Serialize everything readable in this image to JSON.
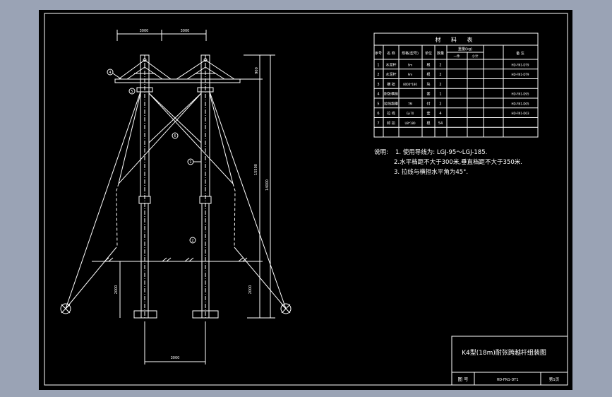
{
  "colors": {
    "frame_bg": "#000000",
    "outer_bg": "#9aa3b5",
    "line": "#ffffff",
    "accent": "#ff3030"
  },
  "dimensions": {
    "top_left": "3000",
    "top_right": "3000",
    "bottom": "3000",
    "crossarm_height": "900",
    "pole_above_ground": "15500",
    "pole_total": "14000",
    "foot_left": "2000",
    "foot_right": "2000"
  },
  "callouts": [
    "4",
    "5",
    "6",
    "1",
    "2"
  ],
  "materials_table": {
    "title": "材 料 表",
    "headers": [
      "序号",
      "名 称",
      "规格(型号)",
      "单位",
      "数量",
      "重量(kg)",
      "备 注"
    ],
    "weight_subheaders": [
      "一件",
      "小计"
    ],
    "rows": [
      {
        "no": "1",
        "name": "水泥杆",
        "spec": "9m",
        "unit": "根",
        "qty": "2",
        "w1": "",
        "w2": "",
        "remark": "HD-FN1-DT9"
      },
      {
        "no": "2",
        "name": "水泥杆",
        "spec": "9m",
        "unit": "根",
        "qty": "2",
        "w1": "",
        "w2": "",
        "remark": "HD-FN1-DT9"
      },
      {
        "no": "3",
        "name": "横 担",
        "spec": "8000*180",
        "unit": "块",
        "qty": "2",
        "w1": "",
        "w2": "",
        "remark": ""
      },
      {
        "no": "4",
        "name": "耐张横担",
        "spec": "",
        "unit": "套",
        "qty": "1",
        "w1": "",
        "w2": "",
        "remark": "HD-FN1-D95"
      },
      {
        "no": "5",
        "name": "拉线抱箍",
        "spec": "7M",
        "unit": "付",
        "qty": "2",
        "w1": "",
        "w2": "",
        "remark": "HD-FN1-D05"
      },
      {
        "no": "6",
        "name": "拉 线",
        "spec": "GJ-70",
        "unit": "套",
        "qty": "4",
        "w1": "",
        "w2": "",
        "remark": "HD-FN1-D03"
      },
      {
        "no": "7",
        "name": "卸 扣",
        "spec": "U8*180",
        "unit": "根",
        "qty": "54",
        "w1": "",
        "w2": "",
        "remark": ""
      },
      {
        "no": "",
        "name": "",
        "spec": "",
        "unit": "",
        "qty": "",
        "w1": "",
        "w2": "",
        "remark": ""
      }
    ]
  },
  "notes": {
    "label": "说明:",
    "items": [
      "1. 使用导线为: LGJ-95～LGJ-185.",
      "2.水平档距不大于300米,垂直档距不大于350米.",
      "3. 拉线与横担水平角为45°."
    ]
  },
  "title_block": {
    "title": "K4型(18m)耐张跨越杆组装图",
    "drawing_no_label": "图 号",
    "drawing_no": "HD-FN1-DT1",
    "sheet": "第1页"
  }
}
